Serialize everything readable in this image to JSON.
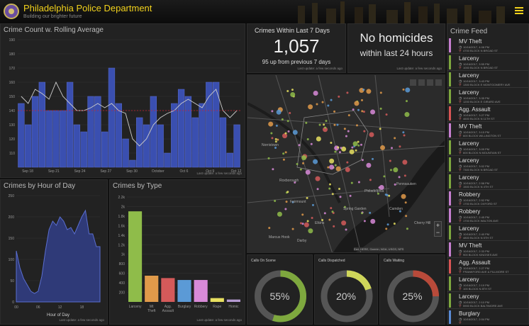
{
  "header": {
    "title": "Philadelphia Police Department",
    "subtitle": "Building our brighter future"
  },
  "rolling": {
    "title": "Crime Count w. Rolling Average",
    "footer": "Last update: a few seconds ago",
    "y_ticks": [
      "190",
      "180",
      "170",
      "160",
      "150",
      "140",
      "130",
      "120",
      "110"
    ],
    "x_ticks": [
      "Sep 18",
      "Sep 21",
      "Sep 24",
      "Sep 27",
      "Sep 30",
      "October",
      "Oct 6",
      "Oct 9",
      "Oct 12"
    ]
  },
  "hour": {
    "title": "Crimes by Hour of Day",
    "xlabel": "Hour of Day",
    "y_ticks": [
      "250",
      "200",
      "150",
      "100",
      "50",
      "0"
    ],
    "x_ticks": [
      "00",
      "06",
      "12",
      "18"
    ],
    "footer": "Last update: a few seconds ago"
  },
  "type": {
    "title": "Crimes by Type",
    "footer": "Last update: a few seconds ago",
    "y_ticks": [
      "2.2k",
      "2k",
      "1.8k",
      "1.6k",
      "1.4k",
      "1.2k",
      "1k",
      "800",
      "600",
      "400",
      "200"
    ],
    "labels": [
      [
        "Larceny"
      ],
      [
        "Mt",
        "Theft"
      ],
      [
        "Agg.",
        "Assault"
      ],
      [
        "Burglary"
      ],
      [
        "Robbery"
      ],
      [
        "Rape"
      ],
      [
        "Homic"
      ]
    ]
  },
  "kpi1": {
    "title": "Crimes Within Last 7 Days",
    "value": "1,057",
    "note": "95 up from previous 7 days",
    "footer": "Last update: a few seconds ago"
  },
  "kpi2": {
    "line1": "No homicides",
    "line2": "within last 24 hours",
    "footer": "Last update: a few seconds ago"
  },
  "map": {
    "labels": [
      "Norristown",
      "Roxborough",
      "Fairmount",
      "Elkins",
      "Spring Garden",
      "Philadelphia",
      "Camden",
      "Pennsauken",
      "Cherry Hill",
      "Marcus Hook",
      "Darby"
    ],
    "attribution": "Esri, HERE, Garmin, NGA, USGS, NPS"
  },
  "gauges": [
    {
      "label": "Calls On Scene",
      "text": "55%",
      "pct": 0.55,
      "color": "#7ea83e"
    },
    {
      "label": "Calls Dispatched",
      "text": "20%",
      "pct": 0.2,
      "color": "#cfd65a"
    },
    {
      "label": "Calls Waiting",
      "text": "25%",
      "pct": 0.25,
      "color": "#b84a3a"
    }
  ],
  "feed": {
    "title": "Crime Feed",
    "items": [
      {
        "name": "MV Theft",
        "l1": "10/16/2017, 4:08 PM",
        "l2": "4700 BLOCK N BROAD ST",
        "color": "#c77fd0"
      },
      {
        "name": "Larceny",
        "l1": "10/16/2017, 3:55 PM",
        "l2": "1000 BLOCK N BROAD ST",
        "color": "#7ea83e"
      },
      {
        "name": "Larceny",
        "l1": "10/16/2017, 3:43 PM",
        "l2": "1300 BLOCK E MONTGOMERY AVE",
        "color": "#7ea83e"
      },
      {
        "name": "Larceny",
        "l1": "10/16/2017, 3:35 PM",
        "l2": "1200 BLOCK E GIRARD AVE",
        "color": "#7ea83e"
      },
      {
        "name": "Agg. Assault",
        "l1": "10/16/2017, 3:27 PM",
        "l2": "4600 BLOCK N 11TH ST",
        "color": "#d95555"
      },
      {
        "name": "MV Theft",
        "l1": "10/16/2017, 3:15 PM",
        "l2": "600 BLOCK WILLINGTON ST",
        "color": "#c77fd0"
      },
      {
        "name": "Larceny",
        "l1": "10/16/2017, 3:09 PM",
        "l2": "600 BLOCK N MOUNTAIN ST",
        "color": "#7ea83e"
      },
      {
        "name": "Larceny",
        "l1": "10/16/2017, 3:02 PM",
        "l2": "7300 BLOCK N BROAD ST",
        "color": "#7ea83e"
      },
      {
        "name": "Larceny",
        "l1": "10/16/2017, 2:58 PM",
        "l2": "1500 BLOCK N 4TH ST",
        "color": "#7ea83e"
      },
      {
        "name": "Robbery",
        "l1": "10/16/2017, 2:52 PM",
        "l2": "1700 BLOCK OXFORD ST",
        "color": "#c77fd0"
      },
      {
        "name": "Robbery",
        "l1": "10/16/2017, 2:45 PM",
        "l2": "1700 BLOCK WALTON AVE",
        "color": "#c77fd0"
      },
      {
        "name": "Larceny",
        "l1": "10/16/2017, 2:40 PM",
        "l2": "4800 BLOCK N 5TH ST",
        "color": "#7ea83e"
      },
      {
        "name": "MV Theft",
        "l1": "10/16/2017, 2:33 PM",
        "l2": "900 BLOCK KINGSES AVE",
        "color": "#c77fd0"
      },
      {
        "name": "Agg. Assault",
        "l1": "10/16/2017, 2:27 PM",
        "l2": "FRANKFORD AVE & FILLMORE ST",
        "color": "#d95555"
      },
      {
        "name": "Larceny",
        "l1": "10/16/2017, 2:19 PM",
        "l2": "100 BLOCK N 8TH ST",
        "color": "#7ea83e"
      },
      {
        "name": "Larceny",
        "l1": "10/16/2017, 2:10 PM",
        "l2": "5900 BLOCK BALTIMORE AVE",
        "color": "#7ea83e"
      },
      {
        "name": "Burglary",
        "l1": "10/16/2017, 2:04 PM",
        "l2": "",
        "color": "#5a8bd6"
      }
    ]
  },
  "chart_data": [
    {
      "type": "bar",
      "title": "Crime Count w. Rolling Average",
      "values": [
        145,
        130,
        150,
        160,
        140,
        140,
        140,
        160,
        130,
        125,
        150,
        150,
        125,
        170,
        145,
        120,
        105,
        135,
        130,
        150,
        130,
        110,
        145,
        155,
        150,
        135,
        145,
        160,
        160,
        135,
        110,
        130
      ],
      "series": [
        {
          "name": "rolling",
          "values": [
            150,
            145,
            155,
            152,
            148,
            160,
            150,
            145,
            140,
            140,
            142,
            145,
            142,
            145,
            140,
            138,
            120,
            115,
            120,
            130,
            135,
            138,
            140,
            145,
            148,
            145,
            142,
            150,
            155,
            140,
            135,
            140
          ]
        }
      ],
      "threshold": 140,
      "ylim": [
        100,
        190
      ]
    },
    {
      "type": "area",
      "title": "Crimes by Hour of Day",
      "xlabel": "Hour of Day",
      "values": [
        120,
        80,
        55,
        40,
        25,
        20,
        25,
        60,
        120,
        170,
        190,
        180,
        200,
        190,
        170,
        175,
        160,
        180,
        200,
        215,
        160,
        160,
        130,
        130
      ],
      "ylim": [
        0,
        250
      ]
    },
    {
      "type": "bar",
      "title": "Crimes by Type",
      "categories": [
        "Larceny",
        "Mt Theft",
        "Agg. Assault",
        "Burglary",
        "Robbery",
        "Rape",
        "Homic"
      ],
      "values": [
        1900,
        550,
        500,
        460,
        460,
        80,
        50
      ],
      "colors": [
        "#8fbc4a",
        "#e09a4a",
        "#d45a5a",
        "#5b9ad6",
        "#d88ad8",
        "#e8e060",
        "#b59ad0"
      ],
      "ylim": [
        0,
        2200
      ]
    }
  ]
}
